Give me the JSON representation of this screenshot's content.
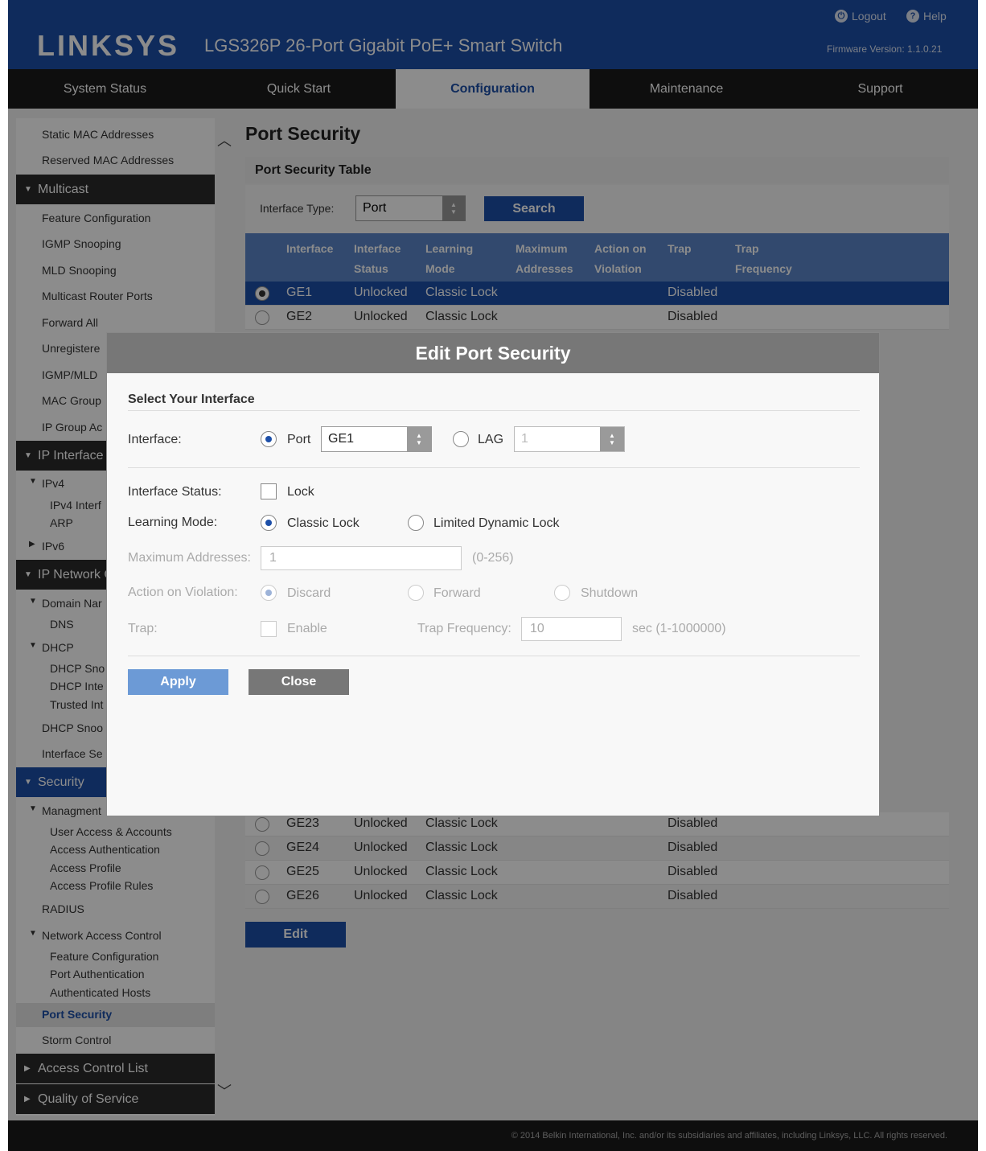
{
  "header": {
    "logo": "LINKSYS",
    "product": "LGS326P 26-Port Gigabit PoE+ Smart Switch",
    "logout": "Logout",
    "help": "Help",
    "firmware": "Firmware Version: 1.1.0.21"
  },
  "nav": {
    "tabs": [
      {
        "label": "System Status"
      },
      {
        "label": "Quick Start"
      },
      {
        "label": "Configuration",
        "active": true
      },
      {
        "label": "Maintenance"
      },
      {
        "label": "Support"
      }
    ]
  },
  "sidebar": {
    "static_mac": "Static MAC Addresses",
    "reserved_mac": "Reserved MAC Addresses",
    "multicast": "Multicast",
    "feature_configuration": "Feature Configuration",
    "igmp_snooping": "IGMP Snooping",
    "mld_snooping": "MLD Snooping",
    "multicast_router_ports": "Multicast Router Ports",
    "forward_all": "Forward All",
    "unregistered": "Unregistere",
    "igmp_mld": "IGMP/MLD",
    "mac_group": "MAC Group",
    "ip_group": "IP Group Ac",
    "ip_interface": "IP Interface",
    "ipv4": "IPv4",
    "ipv4_interface": "IPv4 Interf",
    "arp": "ARP",
    "ipv6": "IPv6",
    "ip_network": "IP Network C",
    "domain_name": "Domain Nar",
    "dns": "DNS",
    "dhcp": "DHCP",
    "dhcp_snooping_short": "DHCP Sno",
    "dhcp_interface": "DHCP Inte",
    "trusted_interfaces": "Trusted Int",
    "dhcp_snooping2": "DHCP Snoo",
    "interface_settings": "Interface Se",
    "security": "Security",
    "management": "Managment",
    "user_access": "User Access & Accounts",
    "access_authentication": "Access Authentication",
    "access_profile": "Access Profile",
    "access_profile_rules": "Access Profile Rules",
    "radius": "RADIUS",
    "network_access_control": "Network Access Control",
    "nac_feature_configuration": "Feature Configuration",
    "port_authentication": "Port Authentication",
    "authenticated_hosts": "Authenticated Hosts",
    "port_security": "Port Security",
    "storm_control": "Storm Control",
    "access_control_list": "Access Control List",
    "quality_of_service": "Quality of Service"
  },
  "main": {
    "title": "Port Security",
    "table_title": "Port Security Table",
    "filter_label": "Interface Type:",
    "filter_value": "Port",
    "search_label": "Search",
    "edit_label": "Edit",
    "columns": {
      "interface": "Interface",
      "interface_status_1": "Interface",
      "interface_status_2": "Status",
      "learning_mode_1": "Learning",
      "learning_mode_2": "Mode",
      "max_addresses_1": "Maximum",
      "max_addresses_2": "Addresses",
      "action_1": "Action on",
      "action_2": "Violation",
      "trap": "Trap",
      "trap_freq_1": "Trap",
      "trap_freq_2": "Frequency"
    },
    "rows_top": [
      {
        "interface": "GE1",
        "status": "Unlocked",
        "mode": "Classic Lock",
        "trap": "Disabled"
      },
      {
        "interface": "GE2",
        "status": "Unlocked",
        "mode": "Classic Lock",
        "trap": "Disabled"
      }
    ],
    "rows_bottom": [
      {
        "interface": "GE23",
        "status": "Unlocked",
        "mode": "Classic Lock",
        "trap": "Disabled"
      },
      {
        "interface": "GE24",
        "status": "Unlocked",
        "mode": "Classic Lock",
        "trap": "Disabled"
      },
      {
        "interface": "GE25",
        "status": "Unlocked",
        "mode": "Classic Lock",
        "trap": "Disabled"
      },
      {
        "interface": "GE26",
        "status": "Unlocked",
        "mode": "Classic Lock",
        "trap": "Disabled"
      }
    ]
  },
  "modal": {
    "title": "Edit Port Security",
    "section": "Select Your Interface",
    "interface_label": "Interface:",
    "port_label": "Port",
    "port_value": "GE1",
    "lag_label": "LAG",
    "lag_value": "1",
    "status_label": "Interface Status:",
    "lock_label": "Lock",
    "learning_label": "Learning Mode:",
    "classic_lock": "Classic Lock",
    "limited_dynamic_lock": "Limited Dynamic Lock",
    "max_label": "Maximum Addresses:",
    "max_value": "1",
    "max_range": "(0-256)",
    "action_label": "Action on Violation:",
    "discard": "Discard",
    "forward": "Forward",
    "shutdown": "Shutdown",
    "trap_label": "Trap:",
    "enable": "Enable",
    "trap_freq_label": "Trap Frequency:",
    "trap_freq_value": "10",
    "trap_freq_range": "sec (1-1000000)",
    "apply": "Apply",
    "close": "Close"
  },
  "footer": {
    "copyright": "© 2014 Belkin International, Inc. and/or its subsidiaries and affiliates, including Linksys, LLC. All rights reserved."
  }
}
